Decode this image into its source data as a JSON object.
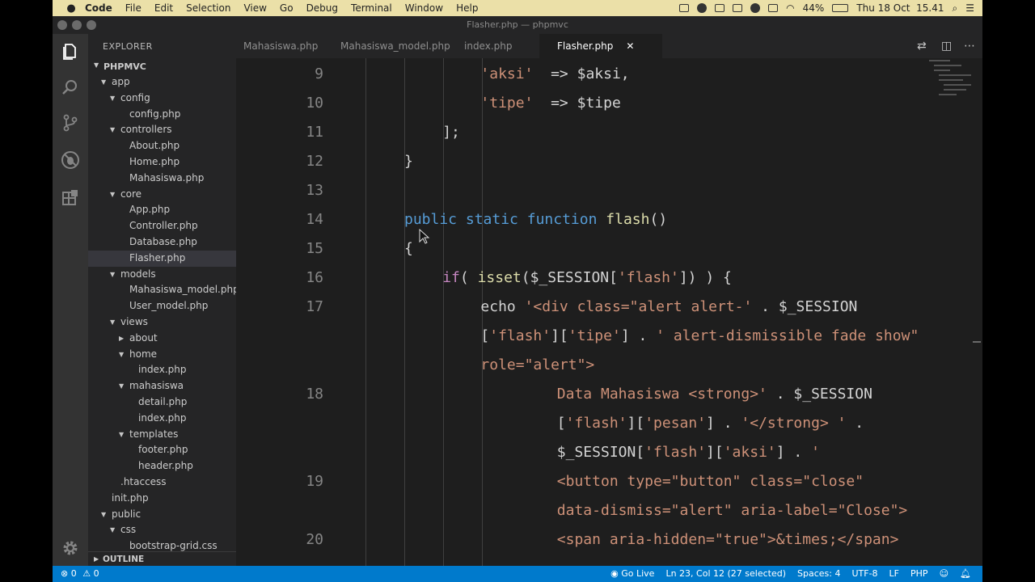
{
  "menubar": {
    "app": "Code",
    "items": [
      "File",
      "Edit",
      "Selection",
      "View",
      "Go",
      "Debug",
      "Terminal",
      "Window",
      "Help"
    ],
    "battery": "44%",
    "clock": "Thu 18 Oct  15.41"
  },
  "window": {
    "title": "Flasher.php — phpmvc"
  },
  "sidebar": {
    "title": "EXPLORER",
    "root": "PHPMVC",
    "tree": [
      {
        "label": "app",
        "depth": 1,
        "type": "folder",
        "open": true
      },
      {
        "label": "config",
        "depth": 2,
        "type": "folder",
        "open": true
      },
      {
        "label": "config.php",
        "depth": 3,
        "type": "file"
      },
      {
        "label": "controllers",
        "depth": 2,
        "type": "folder",
        "open": true
      },
      {
        "label": "About.php",
        "depth": 3,
        "type": "file"
      },
      {
        "label": "Home.php",
        "depth": 3,
        "type": "file"
      },
      {
        "label": "Mahasiswa.php",
        "depth": 3,
        "type": "file"
      },
      {
        "label": "core",
        "depth": 2,
        "type": "folder",
        "open": true
      },
      {
        "label": "App.php",
        "depth": 3,
        "type": "file"
      },
      {
        "label": "Controller.php",
        "depth": 3,
        "type": "file"
      },
      {
        "label": "Database.php",
        "depth": 3,
        "type": "file"
      },
      {
        "label": "Flasher.php",
        "depth": 3,
        "type": "file",
        "selected": true
      },
      {
        "label": "models",
        "depth": 2,
        "type": "folder",
        "open": true
      },
      {
        "label": "Mahasiswa_model.php",
        "depth": 3,
        "type": "file"
      },
      {
        "label": "User_model.php",
        "depth": 3,
        "type": "file"
      },
      {
        "label": "views",
        "depth": 2,
        "type": "folder",
        "open": true
      },
      {
        "label": "about",
        "depth": 3,
        "type": "folder",
        "open": false
      },
      {
        "label": "home",
        "depth": 3,
        "type": "folder",
        "open": true
      },
      {
        "label": "index.php",
        "depth": 4,
        "type": "file"
      },
      {
        "label": "mahasiswa",
        "depth": 3,
        "type": "folder",
        "open": true
      },
      {
        "label": "detail.php",
        "depth": 4,
        "type": "file"
      },
      {
        "label": "index.php",
        "depth": 4,
        "type": "file"
      },
      {
        "label": "templates",
        "depth": 3,
        "type": "folder",
        "open": true
      },
      {
        "label": "footer.php",
        "depth": 4,
        "type": "file"
      },
      {
        "label": "header.php",
        "depth": 4,
        "type": "file"
      },
      {
        "label": ".htaccess",
        "depth": 2,
        "type": "file"
      },
      {
        "label": "init.php",
        "depth": 1,
        "type": "file"
      },
      {
        "label": "public",
        "depth": 1,
        "type": "folder",
        "open": true
      },
      {
        "label": "css",
        "depth": 2,
        "type": "folder",
        "open": true
      },
      {
        "label": "bootstrap-grid.css",
        "depth": 3,
        "type": "file"
      }
    ],
    "outline": "OUTLINE"
  },
  "tabs": [
    {
      "label": "Mahasiswa.php",
      "active": false
    },
    {
      "label": "Mahasiswa_model.php",
      "active": false
    },
    {
      "label": "index.php",
      "active": false
    },
    {
      "label": "Flasher.php",
      "active": true
    }
  ],
  "colors": {
    "keyword": "#569cd6",
    "control": "#c586c0",
    "string": "#ce9178",
    "variable": "#9cdcfe",
    "function": "#dcdcaa",
    "text": "#d4d4d4",
    "statusbar": "#007acc"
  },
  "code": [
    {
      "num": "9",
      "indent": 4,
      "tokens": [
        [
          "string",
          "'aksi'"
        ],
        [
          "text",
          "  => $aksi,"
        ]
      ]
    },
    {
      "num": "10",
      "indent": 4,
      "tokens": [
        [
          "string",
          "'tipe'"
        ],
        [
          "text",
          "  => $tipe"
        ]
      ]
    },
    {
      "num": "11",
      "indent": 2,
      "tokens": [
        [
          "text",
          "];"
        ]
      ]
    },
    {
      "num": "12",
      "indent": 0,
      "tokens": [
        [
          "text",
          "}"
        ]
      ]
    },
    {
      "num": "13",
      "indent": 0,
      "tokens": []
    },
    {
      "num": "14",
      "indent": 0,
      "tokens": [
        [
          "keyword",
          "public"
        ],
        [
          "text",
          " "
        ],
        [
          "keyword",
          "static"
        ],
        [
          "text",
          " "
        ],
        [
          "keyword",
          "function"
        ],
        [
          "text",
          " "
        ],
        [
          "function",
          "flash"
        ],
        [
          "text",
          "()"
        ]
      ]
    },
    {
      "num": "15",
      "indent": 0,
      "tokens": [
        [
          "text",
          "{"
        ]
      ]
    },
    {
      "num": "16",
      "indent": 2,
      "tokens": [
        [
          "control",
          "if"
        ],
        [
          "text",
          "( "
        ],
        [
          "function",
          "isset"
        ],
        [
          "text",
          "($_SESSION["
        ],
        [
          "string",
          "'flash'"
        ],
        [
          "text",
          "]) ) {"
        ]
      ]
    },
    {
      "num": "17",
      "indent": 4,
      "tokens": [
        [
          "text",
          "echo "
        ],
        [
          "string",
          "'<div class=\"alert alert-'"
        ],
        [
          "text",
          " . $_SESSION"
        ]
      ]
    },
    {
      "num": "",
      "indent": 4,
      "tokens": [
        [
          "text",
          "["
        ],
        [
          "string",
          "'flash'"
        ],
        [
          "text",
          "]["
        ],
        [
          "string",
          "'tipe'"
        ],
        [
          "text",
          "] . "
        ],
        [
          "string",
          "' alert-dismissible fade show\""
        ]
      ]
    },
    {
      "num": "",
      "indent": 4,
      "tokens": [
        [
          "string",
          "role=\"alert\">"
        ]
      ]
    },
    {
      "num": "18",
      "indent": 8,
      "tokens": [
        [
          "string",
          "Data Mahasiswa <strong>'"
        ],
        [
          "text",
          " . $_SESSION"
        ]
      ]
    },
    {
      "num": "",
      "indent": 8,
      "tokens": [
        [
          "text",
          "["
        ],
        [
          "string",
          "'flash'"
        ],
        [
          "text",
          "]["
        ],
        [
          "string",
          "'pesan'"
        ],
        [
          "text",
          "] . "
        ],
        [
          "string",
          "'</strong> '"
        ],
        [
          "text",
          " ."
        ]
      ]
    },
    {
      "num": "",
      "indent": 8,
      "tokens": [
        [
          "text",
          "$_SESSION["
        ],
        [
          "string",
          "'flash'"
        ],
        [
          "text",
          "]["
        ],
        [
          "string",
          "'aksi'"
        ],
        [
          "text",
          "] . "
        ],
        [
          "string",
          "'"
        ]
      ]
    },
    {
      "num": "19",
      "indent": 8,
      "tokens": [
        [
          "string",
          "<button type=\"button\" class=\"close\""
        ]
      ]
    },
    {
      "num": "",
      "indent": 8,
      "tokens": [
        [
          "string",
          "data-dismiss=\"alert\" aria-label=\"Close\">"
        ]
      ]
    },
    {
      "num": "20",
      "indent": 8,
      "tokens": [
        [
          "string",
          "<span aria-hidden=\"true\">&times;</span>"
        ]
      ]
    }
  ],
  "status": {
    "errors": "0",
    "warnings": "0",
    "golive": "Go Live",
    "position": "Ln 23, Col 12 (27 selected)",
    "spaces": "Spaces: 4",
    "encoding": "UTF-8",
    "eol": "LF",
    "language": "PHP"
  }
}
